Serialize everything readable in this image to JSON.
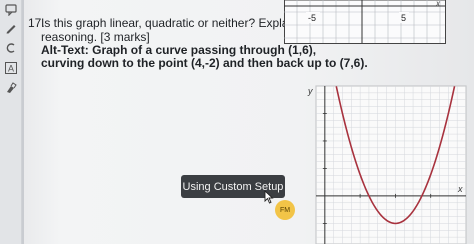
{
  "question": {
    "number": "17.",
    "line1": "Is this graph linear, quadratic or neither? Explain your",
    "line2": "reasoning. [3 marks]",
    "alt_line1": "Alt-Text: Graph of a curve passing through (1,6),",
    "alt_line2": "curving down to the point (4,-2) and then back up to (7,6)."
  },
  "top_graph": {
    "tick_left": "-5",
    "tick_right": "5",
    "axis_label": "x"
  },
  "main_graph": {
    "y_axis_label": "y",
    "x_axis_label": "x"
  },
  "chart_data": {
    "type": "line",
    "x": [
      1,
      2,
      3,
      4,
      5,
      6,
      7
    ],
    "y": [
      6,
      0.5,
      -1.5,
      -2,
      -1.5,
      0.5,
      6
    ],
    "title": "",
    "xlabel": "x",
    "ylabel": "y",
    "xlim": [
      -0.5,
      8
    ],
    "ylim": [
      -3.5,
      8
    ]
  },
  "tooltip": {
    "label": "Using Custom Setup"
  },
  "avatar": {
    "initials": "FM"
  },
  "colors": {
    "curve": "#a8323e",
    "avatar_bg": "#f2c447",
    "tooltip_bg": "#3b3e42"
  },
  "toolbar_icons": [
    "comment-icon",
    "pen-icon",
    "eraser-icon",
    "text-box-icon",
    "highlighter-icon"
  ]
}
